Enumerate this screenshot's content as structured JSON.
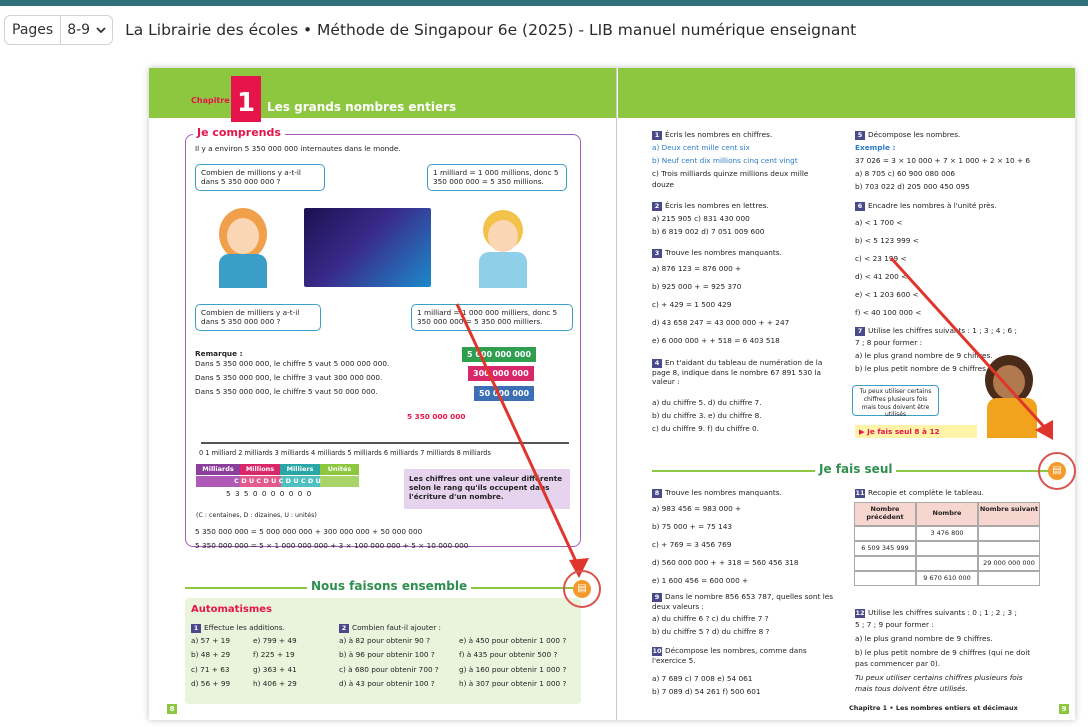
{
  "toolbar": {
    "pages_label": "Pages",
    "pages_value": "8-9",
    "doc_title": "La Librairie des écoles • Méthode de Singapour 6e (2025) - LIB manuel numérique enseignant"
  },
  "left": {
    "chap_label": "Chapitre",
    "chap_num": "1",
    "chap_title": "Les grands nombres entiers",
    "je_comprends": "Je comprends",
    "intro": "Il y a environ 5 350 000 000 internautes dans le monde.",
    "bubble1": "Combien de millions y a-t-il dans 5 350 000 000 ?",
    "bubble2": "1 milliard = 1 000 millions, donc 5 350 000 000 = 5 350 millions.",
    "bubble3": "Combien de milliers y a-t-il dans 5 350 000 000 ?",
    "bubble4": "1 milliard = 1 000 000 milliers, donc 5 350 000 000 = 5 350 000 milliers.",
    "remarque": "Remarque :",
    "rem1": "Dans 5 350 000 000, le chiffre 5 vaut 5 000 000 000.",
    "rem2": "Dans 5 350 000 000, le chiffre 3 vaut 300 000 000.",
    "rem3": "Dans 5 350 000 000, le chiffre 5 vaut 50 000 000.",
    "tag1": "5 000 000 000",
    "tag2": "300 000 000",
    "tag3": "50 000 000",
    "ruler_value": "5 350 000 000",
    "ruler_labels": "0      1 milliard  2 milliards  3 milliards  4 milliards  5 milliards  6 milliards  7 milliards  8 milliards",
    "col_heads": [
      "Milliards",
      "Millions",
      "Milliers",
      "Unités"
    ],
    "digits_row": "5  3  5  0  0  0  0  0  0  0",
    "legend": "(C : centaines, D : dizaines, U : unités)",
    "note": "Les chiffres ont une valeur différente selon le rang qu'ils occupent dans l'écriture d'un nombre.",
    "eq1": "5 350 000 000 = 5 000 000 000 + 300 000 000 + 50 000 000",
    "eq2": "5 350 000 000 = 5 × 1 000 000 000 + 3 × 100 000 000 + 5 × 10 000 000",
    "nous": "Nous faisons ensemble",
    "auto": "Automatismes",
    "ex1_title": "Effectue les additions.",
    "ex1": [
      "a) 57 + 19",
      "b) 48 + 29",
      "c) 71 + 63",
      "d) 56 + 99"
    ],
    "ex1b": [
      "e) 799 + 49",
      "f) 225 + 19",
      "g) 363 + 41",
      "h) 406 + 29"
    ],
    "ex2_title": "Combien faut-il ajouter :",
    "ex2": [
      "a) à 82 pour obtenir 90 ?",
      "b) à 96 pour obtenir 100 ?",
      "c) à 680 pour obtenir 700 ?",
      "d) à 43 pour obtenir 100 ?"
    ],
    "ex2b": [
      "e) à 450 pour obtenir 1 000 ?",
      "f) à 435 pour obtenir 500 ?",
      "g) à 160 pour obtenir 1 000 ?",
      "h) à 307 pour obtenir 1 000 ?"
    ],
    "page_num": "8"
  },
  "right": {
    "e1_title": "Écris les nombres en chiffres.",
    "e1": [
      "a) Deux cent mille cent six",
      "b) Neuf cent dix millions cinq cent vingt",
      "c) Trois milliards quinze millions deux mille",
      "douze"
    ],
    "e2_title": "Écris les nombres en lettres.",
    "e2": [
      "a) 215 905          c) 831 430 000",
      "b) 6 819 002         d) 7 051 009 600"
    ],
    "e3_title": "Trouve les nombres manquants.",
    "e3": [
      "a) 876 123 = 876 000 +",
      "b) 925 000 +        = 925 370",
      "c)        + 429 = 1 500 429",
      "d) 43 658 247 = 43 000 000 +        + 247",
      "e) 6 000 000 +        + 518 = 6 403 518"
    ],
    "e4_title": "En t'aidant du tableau de numération de la page 8, indique dans le nombre 67 891 530 la valeur :",
    "e4": [
      "a) du chiffre 5.        d) du chiffre 7.",
      "b) du chiffre 3.        e) du chiffre 8.",
      "c) du chiffre 9.        f) du chiffre 0."
    ],
    "e5_title": "Décompose les nombres.",
    "exemple": "Exemple :",
    "e5_ex": "37 026 = 3 × 10 000 + 7 × 1 000 + 2 × 10 + 6",
    "e5": [
      "a) 8 705            c) 60 900 080 006",
      "b) 703 022          d) 205 000 450 095"
    ],
    "e6_title": "Encadre les nombres à l'unité près.",
    "e6": [
      "a)       < 1 700 <",
      "b)       < 5 123 999 <",
      "c)       < 23 199 <",
      "d)       < 41 200 <",
      "e)       < 1 203 600 <",
      "f)       < 40 100 000 <"
    ],
    "e7_title": "Utilise les chiffres suivants : 1 ; 3 ; 4 ; 6 ;",
    "e7": [
      "7 ; 8 pour former :",
      "a) le plus grand nombre de 9 chiffres.",
      "b) le plus petit nombre de 9 chiffres."
    ],
    "tip": "Tu peux utiliser certains chiffres plusieurs fois mais tous doivent être utilisés",
    "jefais_link": "▶ Je fais seul 8 à 12",
    "jefais": "Je fais seul",
    "e8_title": "Trouve les nombres manquants.",
    "e8": [
      "a) 983 456 = 983 000 +",
      "b) 75 000 +        = 75 143",
      "c)        + 769 = 3 456 769",
      "d) 560 000 000 +        + 318 = 560 456 318",
      "e) 1 600 456 = 600 000 +"
    ],
    "e9_title": "Dans le nombre 856 653 787, quelles sont les deux valeurs :",
    "e9": [
      "a) du chiffre 6 ?        c) du chiffre 7 ?",
      "b) du chiffre 5 ?        d) du chiffre 8 ?"
    ],
    "e10_title": "Décompose les nombres, comme dans l'exercice 5.",
    "e10": [
      "a) 7 689       c) 7 008        e) 54 061",
      "b) 7 089       d) 54 261       f) 500 601"
    ],
    "e11_title": "Recopie et complète le tableau.",
    "t_heads": [
      "Nombre précédent",
      "Nombre",
      "Nombre suivant"
    ],
    "t_vals": [
      "3 476 800",
      "6 509 345 999",
      "29 000 000 000",
      "9 670 610 000"
    ],
    "e12_title": "Utilise les chiffres suivants : 0 ; 1 ; 2 ; 3 ;",
    "e12": [
      "5 ; 7 ; 9 pour former :",
      "a) le plus grand nombre de 9 chiffres.",
      "b) le plus petit nombre de 9 chiffres (qui ne doit",
      "pas commencer par 0)."
    ],
    "e12_note1": "Tu peux utiliser certains chiffres plusieurs fois",
    "e12_note2": "mais tous doivent être utilisés.",
    "footer": "Chapitre 1 • Les nombres entiers et décimaux",
    "page_num": "9"
  }
}
